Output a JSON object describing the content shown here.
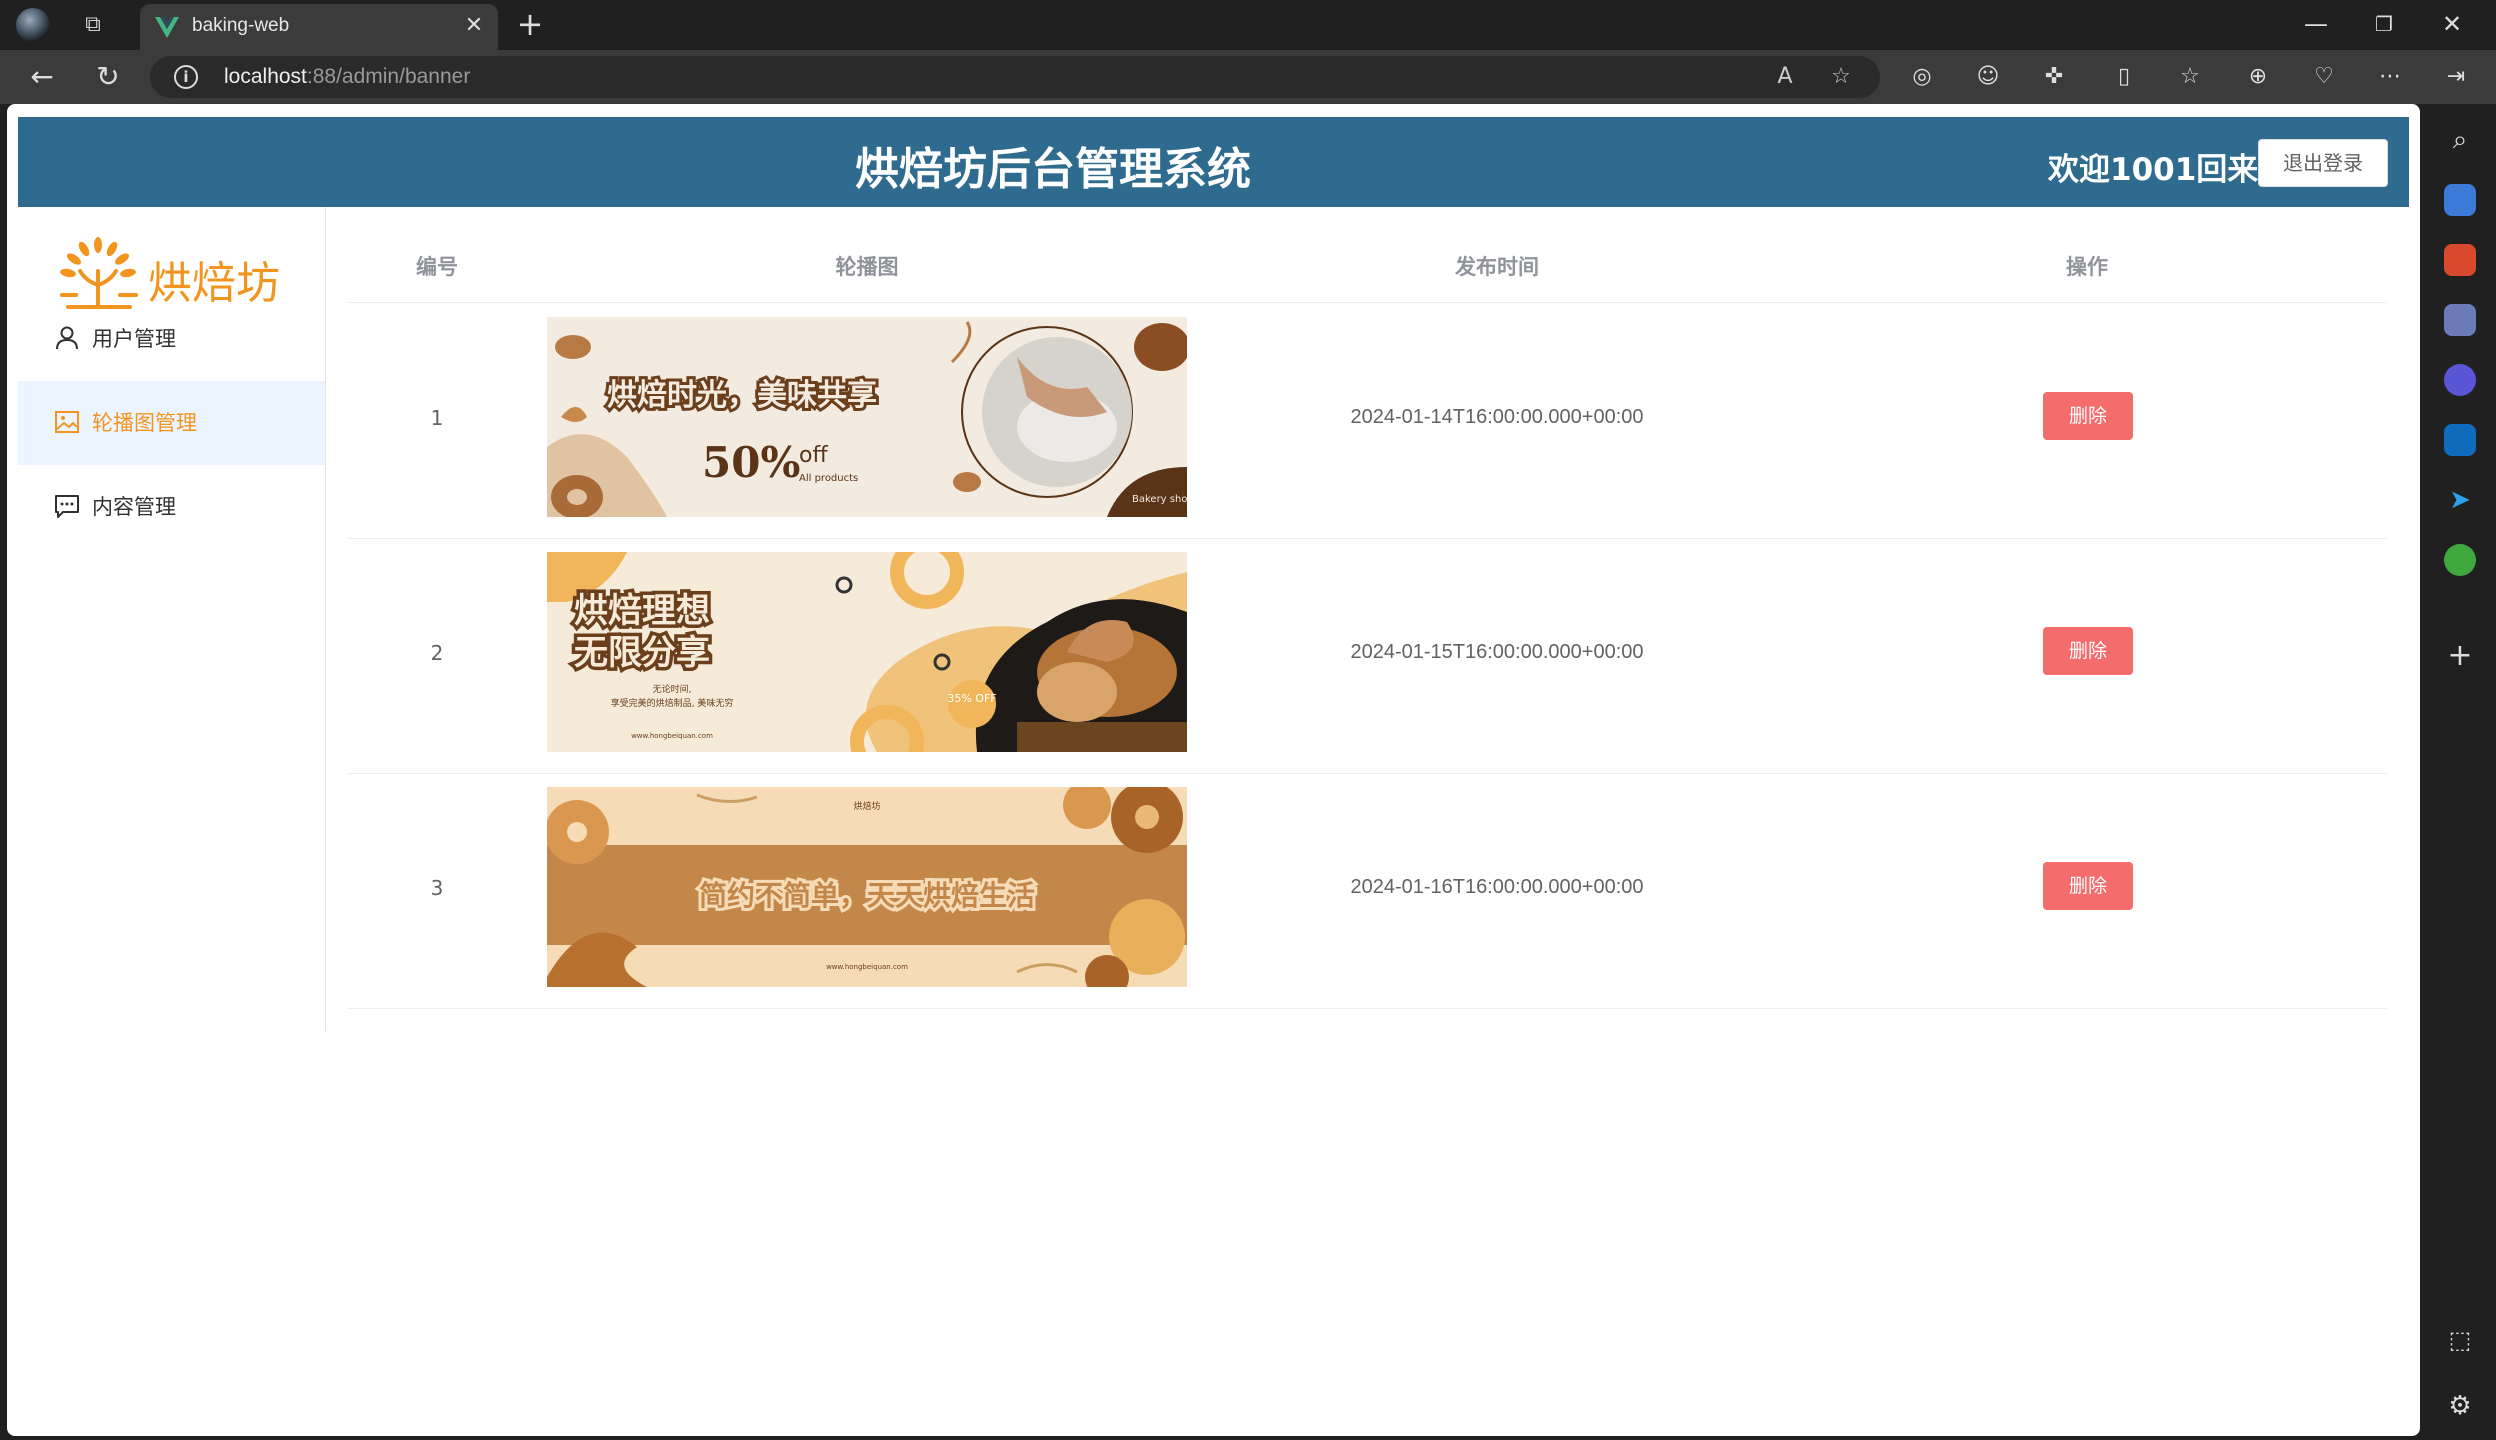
{
  "browser": {
    "tab_title": "baking-web",
    "url_host": "localhost",
    "url_rest": ":88/admin/banner"
  },
  "header": {
    "title": "烘焙坊后台管理系统",
    "welcome": "欢迎1001回来!",
    "logout_label": "退出登录"
  },
  "sidebar": {
    "logo_text": "烘焙坊",
    "items": [
      {
        "label": "用户管理",
        "icon": "user-icon"
      },
      {
        "label": "轮播图管理",
        "icon": "picture-icon"
      },
      {
        "label": "内容管理",
        "icon": "chat-icon"
      }
    ]
  },
  "table": {
    "headers": [
      "编号",
      "轮播图",
      "发布时间",
      "操作"
    ],
    "rows": [
      {
        "id": "1",
        "time": "2024-01-14T16:00:00.000+00:00",
        "banner": {
          "headline": "烘焙时光，美味共享",
          "promo": "50%",
          "promo_suffix": "off",
          "promo_small": "All products",
          "brand": "Bakery shop"
        }
      },
      {
        "id": "2",
        "time": "2024-01-15T16:00:00.000+00:00",
        "banner": {
          "headline1": "烘焙理想",
          "headline2": "无限分享",
          "badge": "35% OFF",
          "sub1": "无论时间,",
          "sub2": "享受完美的烘焙制品, 美味无穷",
          "site": "www.hongbeiquan.com"
        }
      },
      {
        "id": "3",
        "time": "2024-01-16T16:00:00.000+00:00",
        "banner": {
          "brand": "烘焙坊",
          "headline": "简约不简单，天天烘焙生活",
          "site": "www.hongbeiquan.com"
        }
      }
    ],
    "delete_label": "删除"
  },
  "colors": {
    "header_bg": "#2e6b8f",
    "accent": "#f2951e",
    "danger": "#f56c6c"
  }
}
